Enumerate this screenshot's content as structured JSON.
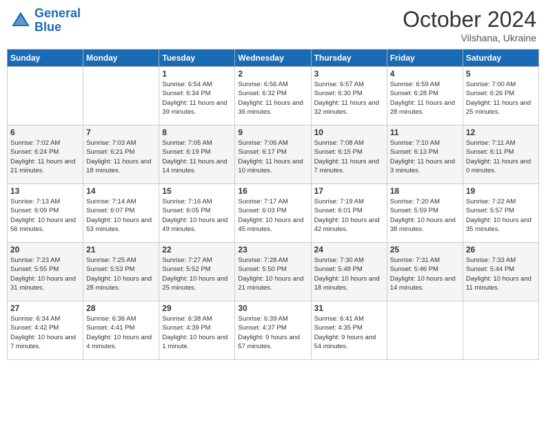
{
  "logo": {
    "line1": "General",
    "line2": "Blue"
  },
  "header": {
    "month": "October 2024",
    "location": "Vilshana, Ukraine"
  },
  "weekdays": [
    "Sunday",
    "Monday",
    "Tuesday",
    "Wednesday",
    "Thursday",
    "Friday",
    "Saturday"
  ],
  "weeks": [
    [
      null,
      null,
      {
        "day": 1,
        "sunrise": "6:54 AM",
        "sunset": "6:34 PM",
        "daylight": "11 hours and 39 minutes."
      },
      {
        "day": 2,
        "sunrise": "6:56 AM",
        "sunset": "6:32 PM",
        "daylight": "11 hours and 36 minutes."
      },
      {
        "day": 3,
        "sunrise": "6:57 AM",
        "sunset": "6:30 PM",
        "daylight": "11 hours and 32 minutes."
      },
      {
        "day": 4,
        "sunrise": "6:59 AM",
        "sunset": "6:28 PM",
        "daylight": "11 hours and 28 minutes."
      },
      {
        "day": 5,
        "sunrise": "7:00 AM",
        "sunset": "6:26 PM",
        "daylight": "11 hours and 25 minutes."
      }
    ],
    [
      {
        "day": 6,
        "sunrise": "7:02 AM",
        "sunset": "6:24 PM",
        "daylight": "11 hours and 21 minutes."
      },
      {
        "day": 7,
        "sunrise": "7:03 AM",
        "sunset": "6:21 PM",
        "daylight": "11 hours and 18 minutes."
      },
      {
        "day": 8,
        "sunrise": "7:05 AM",
        "sunset": "6:19 PM",
        "daylight": "11 hours and 14 minutes."
      },
      {
        "day": 9,
        "sunrise": "7:06 AM",
        "sunset": "6:17 PM",
        "daylight": "11 hours and 10 minutes."
      },
      {
        "day": 10,
        "sunrise": "7:08 AM",
        "sunset": "6:15 PM",
        "daylight": "11 hours and 7 minutes."
      },
      {
        "day": 11,
        "sunrise": "7:10 AM",
        "sunset": "6:13 PM",
        "daylight": "11 hours and 3 minutes."
      },
      {
        "day": 12,
        "sunrise": "7:11 AM",
        "sunset": "6:11 PM",
        "daylight": "11 hours and 0 minutes."
      }
    ],
    [
      {
        "day": 13,
        "sunrise": "7:13 AM",
        "sunset": "6:09 PM",
        "daylight": "10 hours and 56 minutes."
      },
      {
        "day": 14,
        "sunrise": "7:14 AM",
        "sunset": "6:07 PM",
        "daylight": "10 hours and 53 minutes."
      },
      {
        "day": 15,
        "sunrise": "7:16 AM",
        "sunset": "6:05 PM",
        "daylight": "10 hours and 49 minutes."
      },
      {
        "day": 16,
        "sunrise": "7:17 AM",
        "sunset": "6:03 PM",
        "daylight": "10 hours and 45 minutes."
      },
      {
        "day": 17,
        "sunrise": "7:19 AM",
        "sunset": "6:01 PM",
        "daylight": "10 hours and 42 minutes."
      },
      {
        "day": 18,
        "sunrise": "7:20 AM",
        "sunset": "5:59 PM",
        "daylight": "10 hours and 38 minutes."
      },
      {
        "day": 19,
        "sunrise": "7:22 AM",
        "sunset": "5:57 PM",
        "daylight": "10 hours and 35 minutes."
      }
    ],
    [
      {
        "day": 20,
        "sunrise": "7:23 AM",
        "sunset": "5:55 PM",
        "daylight": "10 hours and 31 minutes."
      },
      {
        "day": 21,
        "sunrise": "7:25 AM",
        "sunset": "5:53 PM",
        "daylight": "10 hours and 28 minutes."
      },
      {
        "day": 22,
        "sunrise": "7:27 AM",
        "sunset": "5:52 PM",
        "daylight": "10 hours and 25 minutes."
      },
      {
        "day": 23,
        "sunrise": "7:28 AM",
        "sunset": "5:50 PM",
        "daylight": "10 hours and 21 minutes."
      },
      {
        "day": 24,
        "sunrise": "7:30 AM",
        "sunset": "5:48 PM",
        "daylight": "10 hours and 18 minutes."
      },
      {
        "day": 25,
        "sunrise": "7:31 AM",
        "sunset": "5:46 PM",
        "daylight": "10 hours and 14 minutes."
      },
      {
        "day": 26,
        "sunrise": "7:33 AM",
        "sunset": "5:44 PM",
        "daylight": "10 hours and 11 minutes."
      }
    ],
    [
      {
        "day": 27,
        "sunrise": "6:34 AM",
        "sunset": "4:42 PM",
        "daylight": "10 hours and 7 minutes."
      },
      {
        "day": 28,
        "sunrise": "6:36 AM",
        "sunset": "4:41 PM",
        "daylight": "10 hours and 4 minutes."
      },
      {
        "day": 29,
        "sunrise": "6:38 AM",
        "sunset": "4:39 PM",
        "daylight": "10 hours and 1 minute."
      },
      {
        "day": 30,
        "sunrise": "6:39 AM",
        "sunset": "4:37 PM",
        "daylight": "9 hours and 57 minutes."
      },
      {
        "day": 31,
        "sunrise": "6:41 AM",
        "sunset": "4:35 PM",
        "daylight": "9 hours and 54 minutes."
      },
      null,
      null
    ]
  ],
  "labels": {
    "sunrise": "Sunrise:",
    "sunset": "Sunset:",
    "daylight": "Daylight:"
  }
}
